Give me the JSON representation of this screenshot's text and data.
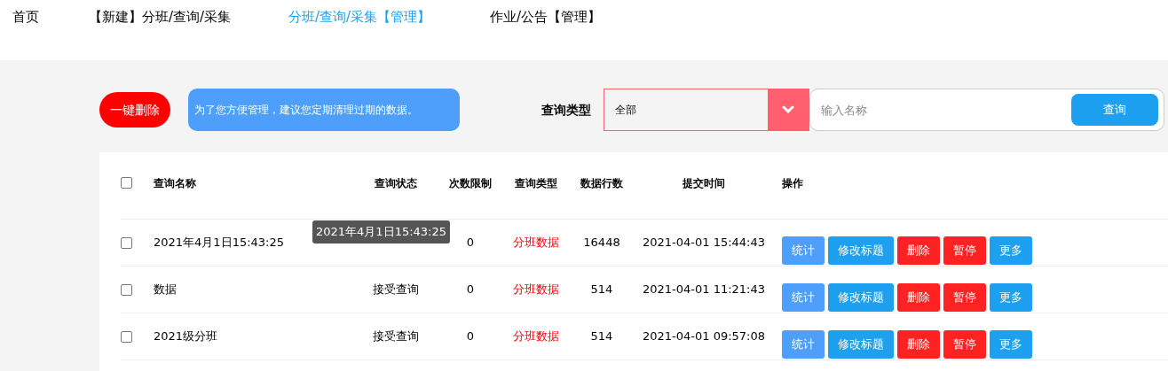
{
  "nav": [
    {
      "label": "首页",
      "selected": false
    },
    {
      "label": "【新建】分班/查询/采集",
      "selected": false
    },
    {
      "label": "分班/查询/采集【管理】",
      "selected": true
    },
    {
      "label": "作业/公告【管理】",
      "selected": false
    }
  ],
  "toolbar": {
    "delete_all": "一键删除",
    "notice": "为了您方便管理，建议您定期清理过期的数据。",
    "type_label": "查询类型",
    "type_select": "全部",
    "search": {
      "placeholder": "输入名称",
      "button": "查询"
    }
  },
  "table": {
    "select_all": {
      "checked": false
    },
    "columns": [
      "查询名称",
      "查询状态",
      "次数限制",
      "查询类型",
      "数据行数",
      "提交时间",
      "操作"
    ],
    "rows": [
      {
        "checked": false,
        "name": "2021年4月1日15:43:25",
        "limit": "0",
        "type": "分班数据",
        "count": "16448",
        "time": "2021-04-01 15:44:43",
        "actions": [
          {
            "label": "统计",
            "kind": "stats"
          },
          {
            "label": "修改标题",
            "kind": "edit"
          },
          {
            "label": "删除",
            "kind": "danger"
          },
          {
            "label": "暂停",
            "kind": "danger"
          },
          {
            "label": "更多",
            "kind": "edit"
          }
        ]
      },
      {
        "checked": false,
        "name": "数据",
        "status": "接受查询",
        "limit": "0",
        "type": "分班数据",
        "count": "514",
        "time": "2021-04-01 11:21:43",
        "actions": [
          {
            "label": "统计",
            "kind": "stats"
          },
          {
            "label": "修改标题",
            "kind": "edit"
          },
          {
            "label": "删除",
            "kind": "danger"
          },
          {
            "label": "暂停",
            "kind": "danger"
          },
          {
            "label": "更多",
            "kind": "edit"
          }
        ]
      },
      {
        "checked": false,
        "name": "2021级分班",
        "status": "接受查询",
        "limit": "0",
        "type": "分班数据",
        "count": "514",
        "time": "2021-04-01 09:57:08",
        "actions": [
          {
            "label": "统计",
            "kind": "stats"
          },
          {
            "label": "修改标题",
            "kind": "edit"
          },
          {
            "label": "删除",
            "kind": "danger"
          },
          {
            "label": "暂停",
            "kind": "danger"
          },
          {
            "label": "更多",
            "kind": "edit"
          }
        ]
      }
    ],
    "tooltip": "2021年4月1日15:43:25"
  }
}
